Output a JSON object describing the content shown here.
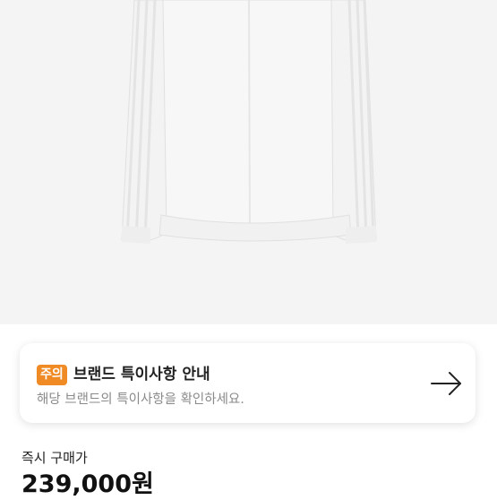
{
  "product": {
    "image_alt": "white track jacket"
  },
  "notice": {
    "badge": "주의",
    "title": "브랜드 특이사항 안내",
    "description": "해당 브랜드의 특이사항을 확인하세요.",
    "arrow_icon": "arrow-right-icon"
  },
  "price": {
    "label": "즉시 구매가",
    "value": "239,000원"
  },
  "colors": {
    "badge": "#f08a24",
    "image_bg": "#f4f4f4"
  }
}
